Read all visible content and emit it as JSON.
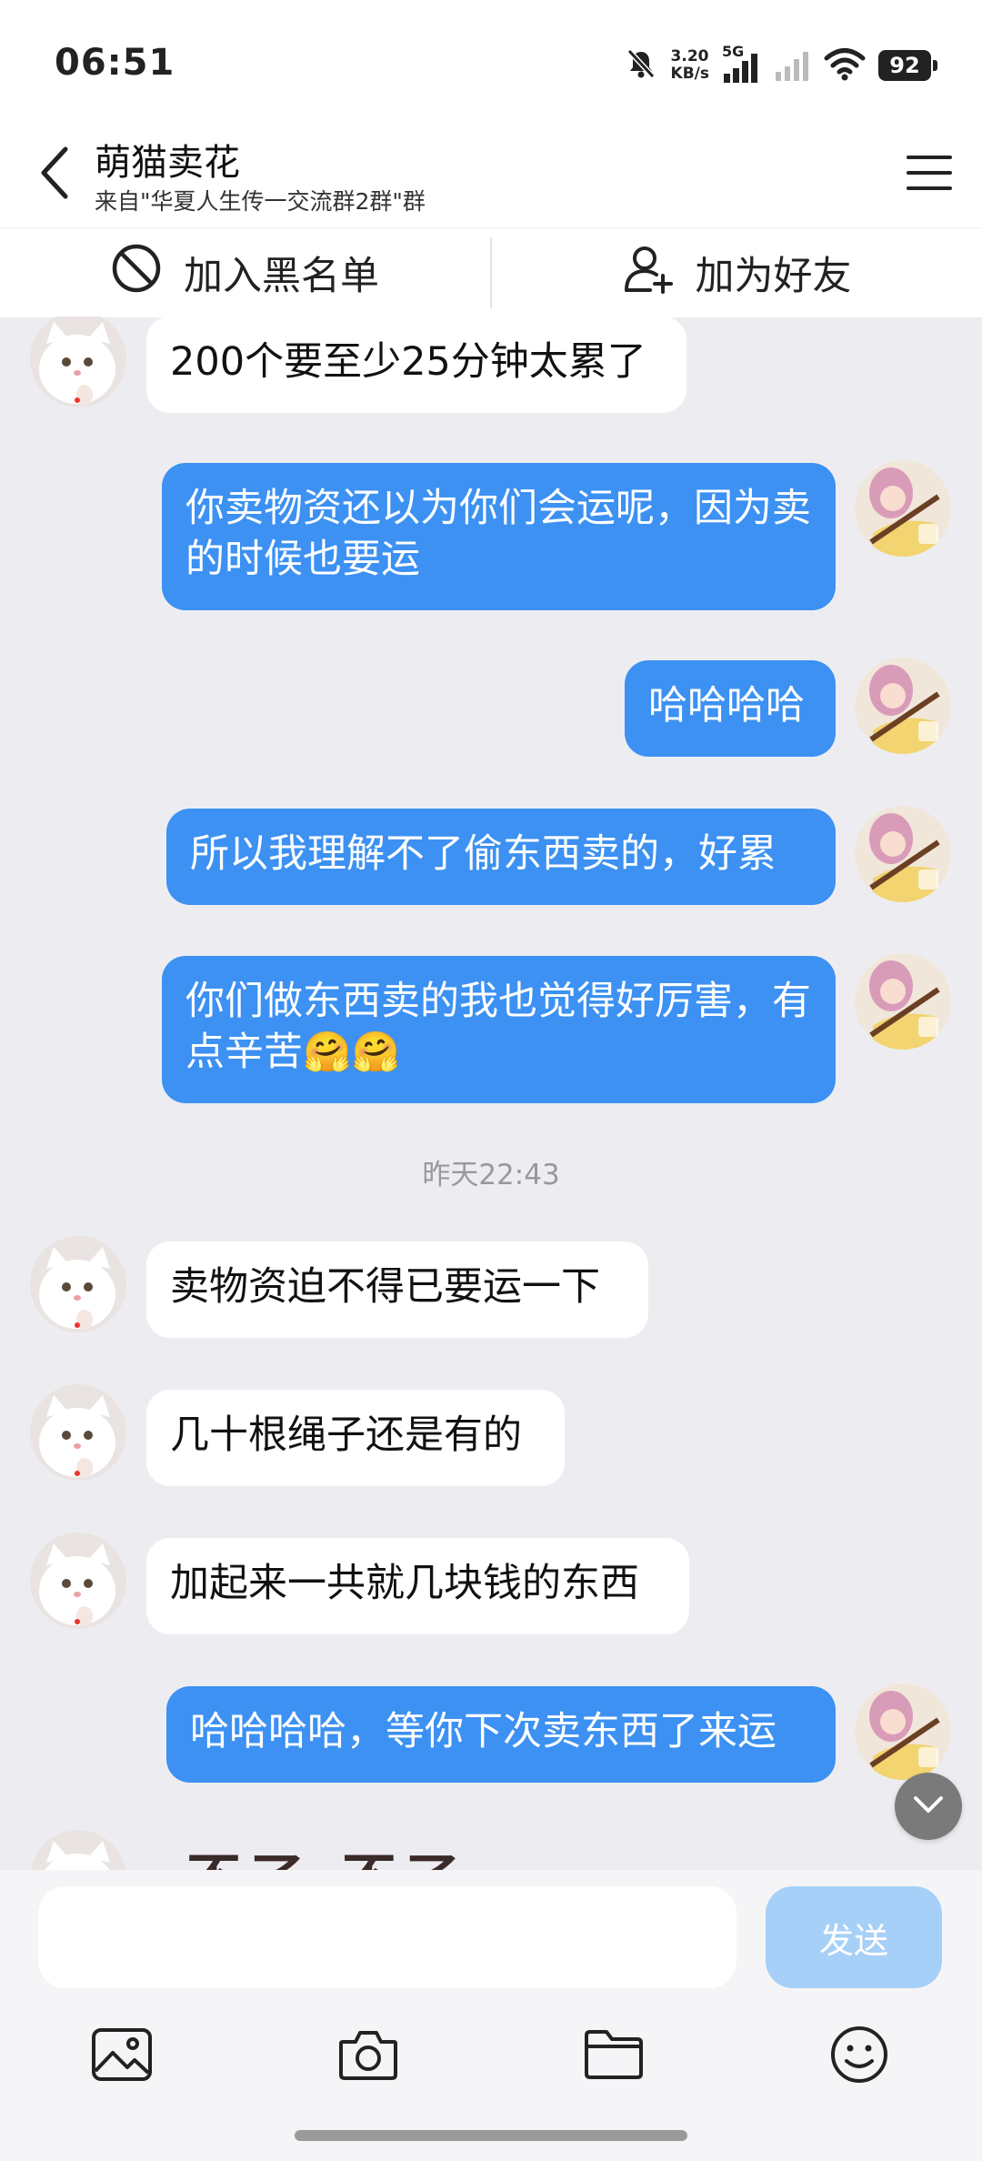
{
  "status_bar": {
    "time": "06:51",
    "net_speed_value": "3.20",
    "net_speed_unit": "KB/s",
    "network_type": "5G",
    "battery_level": "92",
    "icons": [
      "bell-off-icon",
      "signal-icon",
      "signal-weak-icon",
      "wifi-icon",
      "battery-icon"
    ]
  },
  "header": {
    "title": "萌猫卖花",
    "subtitle": "来自\"华夏人生传一交流群2群\"群"
  },
  "actions": {
    "block_label": "加入黑名单",
    "add_friend_label": "加为好友"
  },
  "messages": [
    {
      "side": "in",
      "text": "200个要至少25分钟太累了"
    },
    {
      "side": "out",
      "text": "你卖物资还以为你们会运呢，因为卖的时候也要运"
    },
    {
      "side": "out",
      "text": "哈哈哈哈"
    },
    {
      "side": "out",
      "text": "所以我理解不了偷东西卖的，好累"
    },
    {
      "side": "out",
      "text": "你们做东西卖的我也觉得好厉害，有点辛苦",
      "emoji": "🤗🤗"
    },
    {
      "side": "in",
      "text": "卖物资迫不得已要运一下"
    },
    {
      "side": "in",
      "text": "几十根绳子还是有的"
    },
    {
      "side": "in",
      "text": "加起来一共就几块钱的东西"
    },
    {
      "side": "out",
      "text": "哈哈哈哈，等你下次卖东西了来运"
    },
    {
      "side": "in",
      "text": "不了 不了"
    }
  ],
  "time_divider": "昨天22:43",
  "input": {
    "placeholder": "",
    "send_label": "发送"
  },
  "toolbar_icons": [
    "image-icon",
    "camera-icon",
    "folder-icon",
    "emoji-icon"
  ],
  "colors": {
    "outgoing_bubble": "#3C91F2",
    "incoming_bubble": "#FFFFFF",
    "chat_background": "#EDEDF1",
    "send_disabled": "#A7D0F8"
  }
}
